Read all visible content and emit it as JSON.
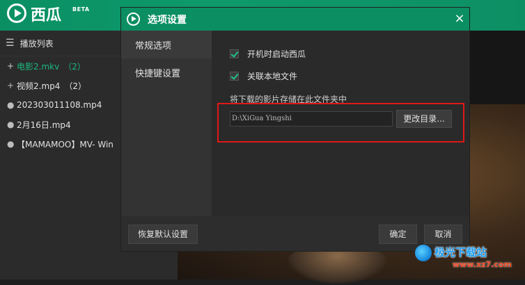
{
  "app": {
    "logo_text": "西瓜",
    "beta_label": "BETA"
  },
  "playlist": {
    "header": "播放列表",
    "items": [
      {
        "bullet": "+",
        "label": "电影2.mkv",
        "count": "（2）",
        "active": true
      },
      {
        "bullet": "+",
        "label": "视频2.mp4",
        "count": "（2）",
        "active": false
      },
      {
        "bullet": "●",
        "label": "202303011108.mp4",
        "count": "",
        "active": false
      },
      {
        "bullet": "●",
        "label": "2月16日.mp4",
        "count": "",
        "active": false
      },
      {
        "bullet": "●",
        "label": "【MAMAMOO】MV- Win",
        "count": "",
        "active": false
      }
    ]
  },
  "dialog": {
    "title": "选项设置",
    "close_symbol": "×",
    "nav": [
      {
        "label": "常规选项",
        "selected": true
      },
      {
        "label": "快捷键设置",
        "selected": false
      }
    ],
    "options": [
      {
        "label": "开机时启动西瓜",
        "checked": true
      },
      {
        "label": "关联本地文件",
        "checked": true
      }
    ],
    "save_label": "将下载的影片存储在此文件夹中",
    "path_value": "D:\\XiGua Yingshi",
    "change_dir_button": "更改目录...",
    "reset_button": "恢复默认设置",
    "ok_button": "确定",
    "cancel_button": "取消"
  },
  "watermark": {
    "text": "极光下载站",
    "url": "www.xz7.com"
  },
  "colors": {
    "brand_green": "#0b8f62",
    "active_item": "#1bb980",
    "highlight_red": "#e01818"
  }
}
